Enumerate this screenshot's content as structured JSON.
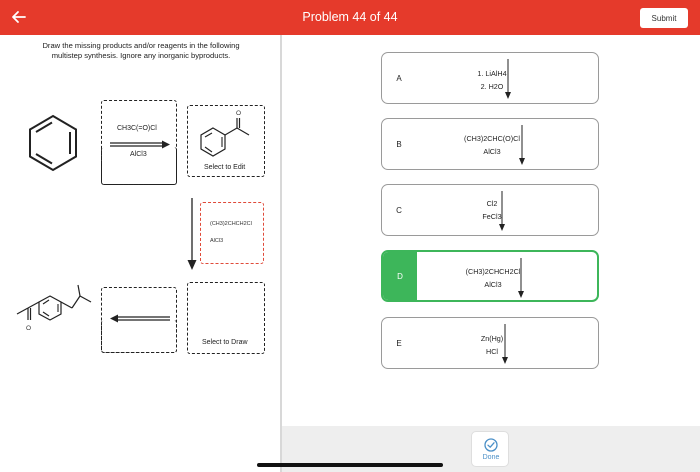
{
  "header": {
    "title": "Problem 44 of 44",
    "submit_label": "Submit",
    "bg_color": "#e53a2b"
  },
  "question": {
    "instructions_line1": "Draw the missing products and/or reagents in the following",
    "instructions_line2": "multistep synthesis. Ignore any inorganic byproducts."
  },
  "scheme": {
    "step1_reagent_top": "CH3C(=O)Cl",
    "step1_reagent_bottom": "AlCl3",
    "product1_caption": "Select to Edit",
    "product1_carbonyl_o": "O",
    "step2_reagent_top": "(CH3)2CHCH2Cl",
    "step2_reagent_bottom": "AlCl3",
    "product2_caption": "Select to Draw",
    "final_product_o": "O"
  },
  "options": [
    {
      "letter": "A",
      "line1": "1. LiAlH4",
      "line2": "2. H2O",
      "selected": false
    },
    {
      "letter": "B",
      "line1": "(CH3)2CHC(O)Cl",
      "line2": "AlCl3",
      "selected": false
    },
    {
      "letter": "C",
      "line1": "Cl2",
      "line2": "FeCl3",
      "selected": false
    },
    {
      "letter": "D",
      "line1": "(CH3)2CHCH2Cl",
      "line2": "AlCl3",
      "selected": true
    },
    {
      "letter": "E",
      "line1": "Zn(Hg)",
      "line2": "HCl",
      "selected": false
    }
  ],
  "footer": {
    "done_label": "Done"
  },
  "colors": {
    "accent_red": "#e53a2b",
    "selected_green": "#3db65a",
    "done_blue": "#4a8fc7"
  }
}
